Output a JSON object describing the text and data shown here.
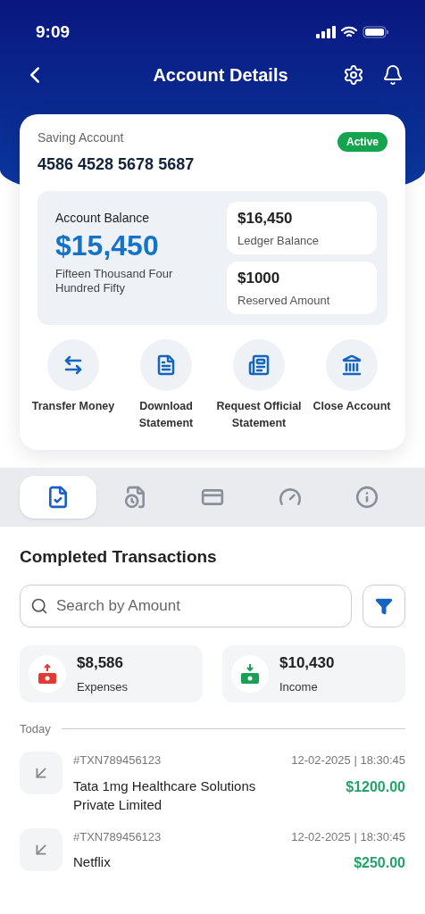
{
  "status_bar": {
    "time": "9:09"
  },
  "header": {
    "title": "Account Details"
  },
  "account": {
    "type": "Saving Account",
    "number": "4586 4528 5678 5687",
    "status": "Active",
    "active": true,
    "balance_label": "Account Balance",
    "balance": "$15,450",
    "balance_words": "Fifteen Thousand Four Hundred Fifty",
    "side": [
      {
        "amount": "$16,450",
        "label": "Ledger Balance"
      },
      {
        "amount": "$1000",
        "label": "Reserved Amount"
      }
    ]
  },
  "actions": [
    {
      "kind": "transfer",
      "label": "Transfer Money"
    },
    {
      "kind": "download",
      "label": "Download Statement"
    },
    {
      "kind": "request",
      "label": "Request Official Statement"
    },
    {
      "kind": "close",
      "label": "Close Account"
    }
  ],
  "tabs": [
    {
      "kind": "completed",
      "selected": true
    },
    {
      "kind": "pending",
      "selected": false
    },
    {
      "kind": "card",
      "selected": false
    },
    {
      "kind": "limits",
      "selected": false
    },
    {
      "kind": "info",
      "selected": false
    }
  ],
  "section_title": "Completed Transactions",
  "search": {
    "placeholder": "Search by Amount"
  },
  "stats": [
    {
      "kind": "expense",
      "amount": "$8,586",
      "label": "Expenses",
      "color": "#e53935"
    },
    {
      "kind": "income",
      "amount": "$10,430",
      "label": "Income",
      "color": "#1aa053"
    }
  ],
  "group_label": "Today",
  "transactions": [
    {
      "id": "#TXN789456123",
      "datetime": "12-02-2025 | 18:30:45",
      "name": "Tata 1mg Healthcare Solutions Private Limited",
      "amount": "$1200.00"
    },
    {
      "id": "#TXN789456123",
      "datetime": "12-02-2025 | 18:30:45",
      "name": "Netflix",
      "amount": "$250.00"
    }
  ]
}
